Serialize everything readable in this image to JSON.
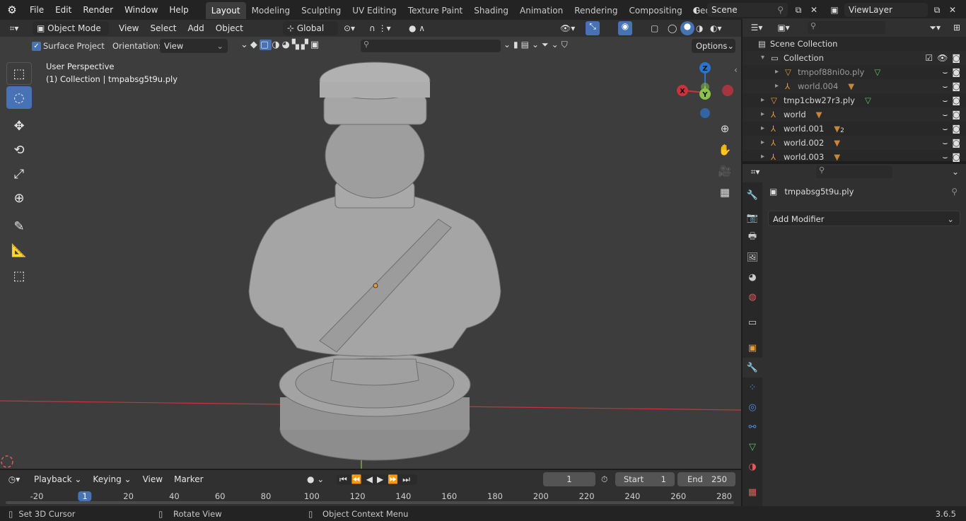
{
  "menu": {
    "file": "File",
    "edit": "Edit",
    "render": "Render",
    "window": "Window",
    "help": "Help"
  },
  "workspaces": [
    "Layout",
    "Modeling",
    "Sculpting",
    "UV Editing",
    "Texture Paint",
    "Shading",
    "Animation",
    "Rendering",
    "Compositing",
    "Geometry Noc"
  ],
  "scene": {
    "label": "Scene",
    "viewlayer": "ViewLayer"
  },
  "viewport_header": {
    "mode": "Object Mode",
    "view": "View",
    "select": "Select",
    "add": "Add",
    "object": "Object",
    "orientation": "Global"
  },
  "tool_settings": {
    "surface_project": "Surface Project",
    "orientation_label": "Orientation:",
    "orientation_value": "View",
    "options": "Options"
  },
  "viewport": {
    "perspective": "User Perspective",
    "collection_info": "(1) Collection | tmpabsg5t9u.ply"
  },
  "gizmo": {
    "z": "Z",
    "y": "Y",
    "x": "X"
  },
  "outliner": {
    "scene_collection": "Scene Collection",
    "items": [
      {
        "label": "Collection",
        "indent": 1
      },
      {
        "label": "tmpof88ni0o.ply",
        "indent": 2
      },
      {
        "label": "world.004",
        "indent": 2
      },
      {
        "label": "tmp1cbw27r3.ply",
        "indent": 0
      },
      {
        "label": "world",
        "indent": 0
      },
      {
        "label": "world.001",
        "indent": 0,
        "badge": "2"
      },
      {
        "label": "world.002",
        "indent": 0
      },
      {
        "label": "world.003",
        "indent": 0
      }
    ]
  },
  "properties": {
    "object_name": "tmpabsg5t9u.ply",
    "add_modifier": "Add Modifier"
  },
  "timeline": {
    "playback": "Playback",
    "keying": "Keying",
    "view": "View",
    "marker": "Marker",
    "current_frame": "1",
    "start_label": "Start",
    "start_value": "1",
    "end_label": "End",
    "end_value": "250",
    "ticks": [
      "-20",
      "1",
      "20",
      "40",
      "60",
      "80",
      "100",
      "120",
      "140",
      "160",
      "180",
      "200",
      "220",
      "240",
      "260",
      "280"
    ]
  },
  "status": {
    "left": "Set 3D Cursor",
    "middle": "Rotate View",
    "right": "Object Context Menu",
    "version": "3.6.5"
  },
  "colors": {
    "accent": "#4772b3",
    "x_axis": "#c9333d",
    "y_axis": "#8bc34a",
    "z_axis": "#2f73c8",
    "object_origin": "#e79b3a"
  }
}
